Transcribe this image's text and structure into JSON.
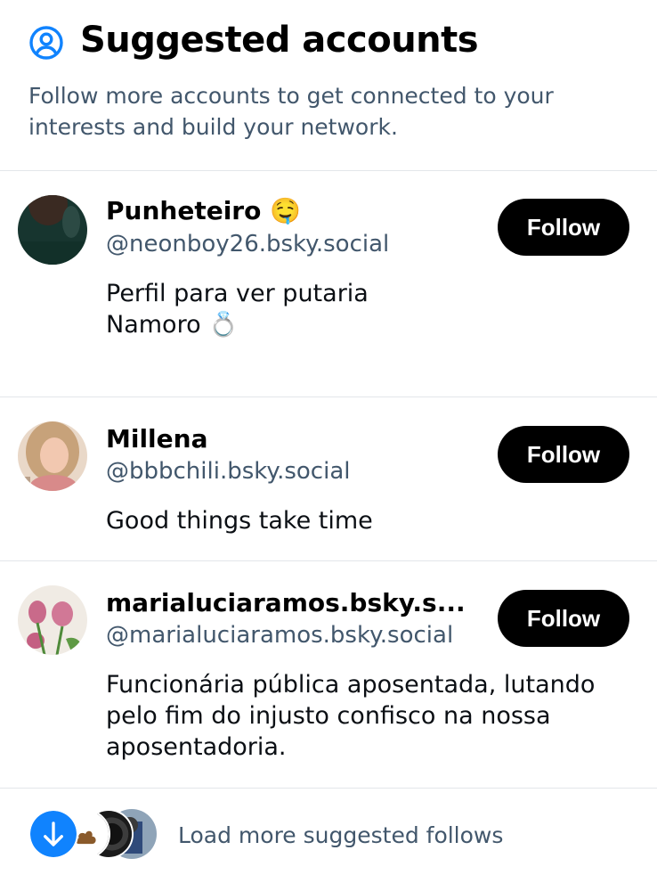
{
  "header": {
    "title": "Suggested accounts",
    "description_line1": "Follow more accounts to get connected to your",
    "description_line2": "interests and build your network."
  },
  "accounts": [
    {
      "name": "Punheteiro 🤤",
      "handle": "@neonboy26.bsky.social",
      "bio_line1": "Perfil para ver putaria",
      "bio_line2": "Namoro 💍",
      "follow_label": "Follow"
    },
    {
      "name": "Millena",
      "handle": "@bbbchili.bsky.social",
      "bio_line1": "Good things take time",
      "follow_label": "Follow"
    },
    {
      "name": "marialuciaramos.bsky.s...",
      "handle": "@marialuciaramos.bsky.social",
      "bio_line1": "Funcionária pública aposentada, lutando",
      "bio_line2": "pelo fim do injusto confisco na nossa",
      "bio_line3": "aposentadoria.",
      "follow_label": "Follow"
    }
  ],
  "footer": {
    "load_more_label": "Load more suggested follows"
  },
  "colors": {
    "accent": "#1083fe",
    "button_bg": "#000000",
    "muted_text": "#42576c",
    "divider": "#e3e6ea"
  },
  "icons": {
    "header": "user-circle-icon",
    "load_more": "arrow-down-icon"
  }
}
